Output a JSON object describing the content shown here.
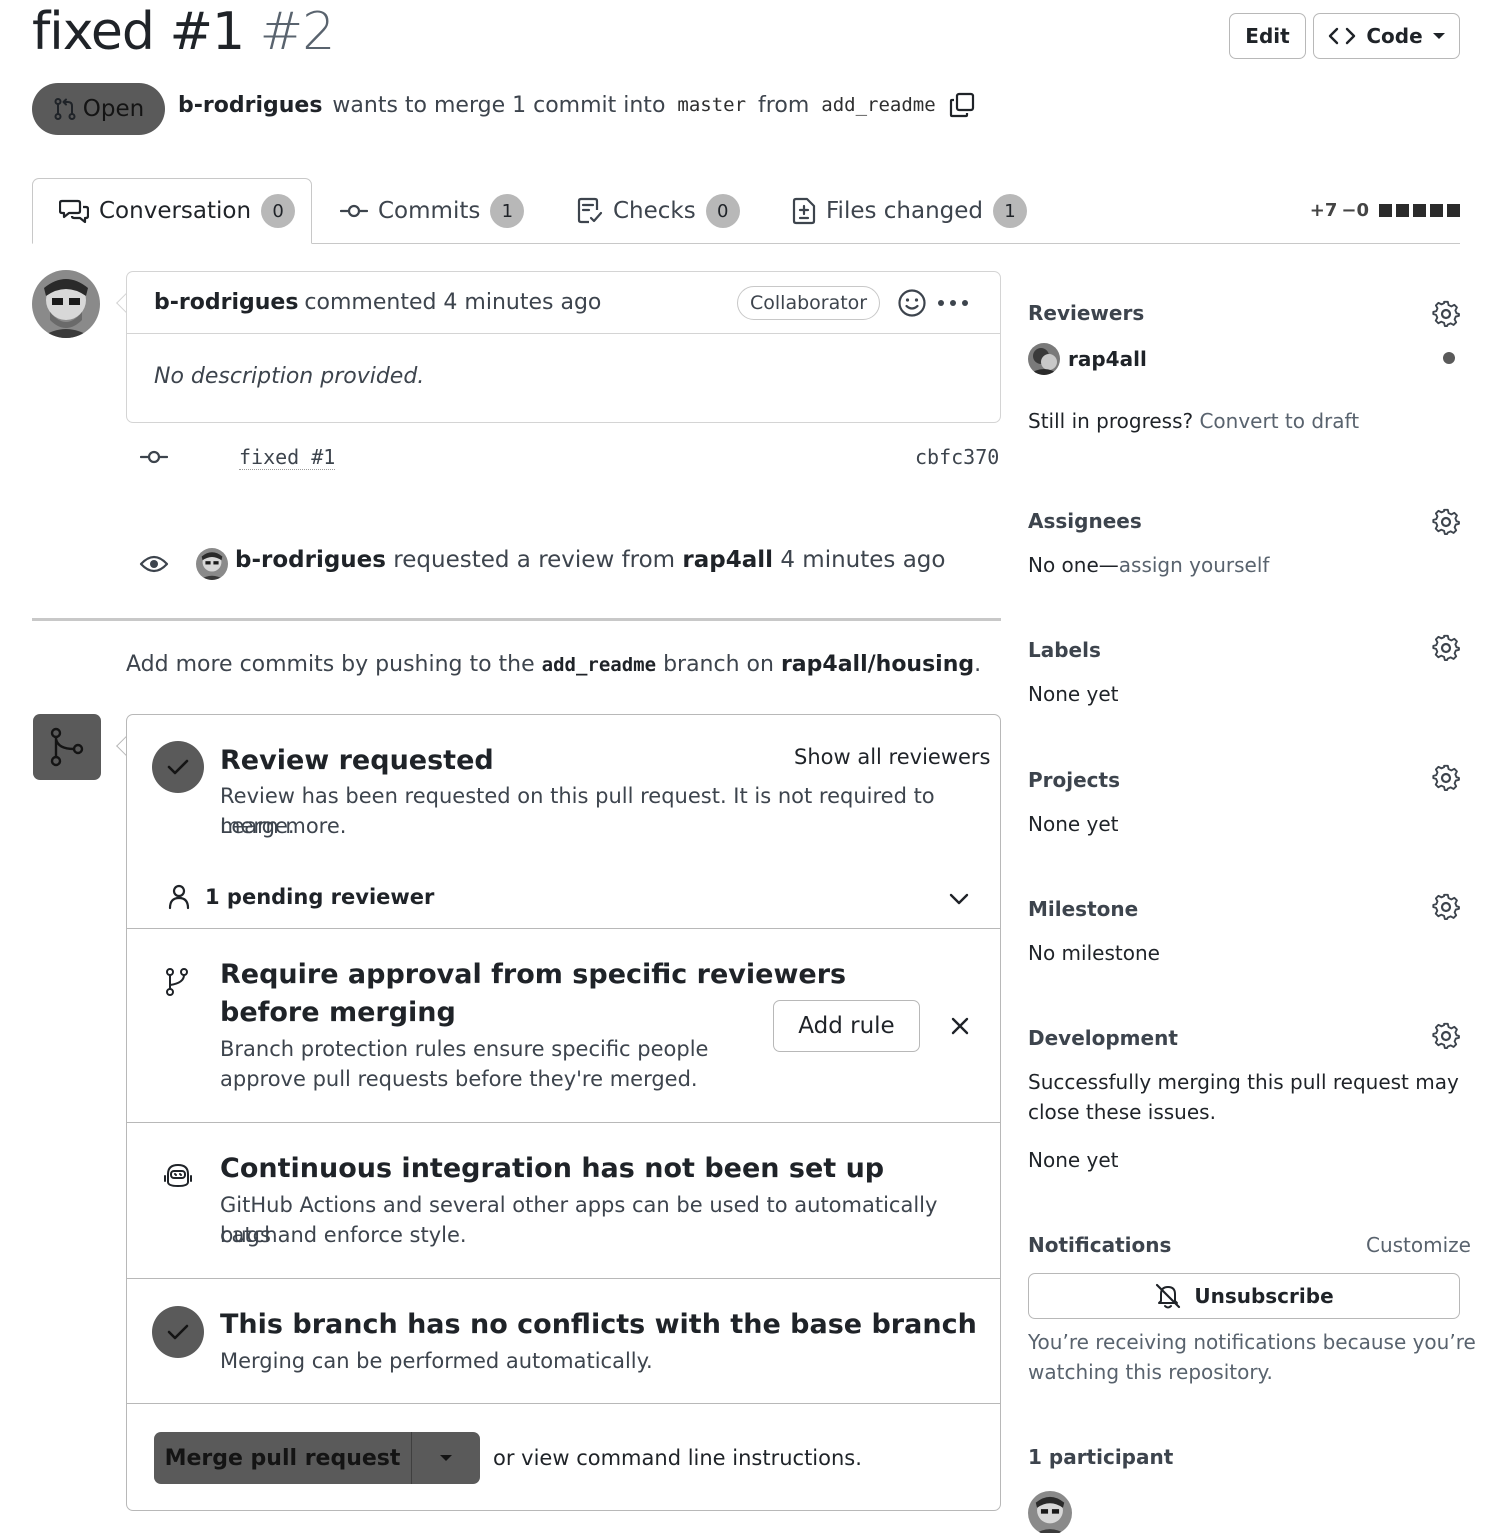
{
  "header": {
    "title": "fixed #1",
    "number": "#2",
    "edit_label": "Edit",
    "code_label": "Code",
    "state_label": "Open",
    "author": "b-rodrigues",
    "merge_text": "wants to merge 1 commit into",
    "base_branch": "master",
    "from_text": "from",
    "head_branch": "add_readme"
  },
  "tabs": [
    {
      "label": "Conversation",
      "count": "0"
    },
    {
      "label": "Commits",
      "count": "1"
    },
    {
      "label": "Checks",
      "count": "0"
    },
    {
      "label": "Files changed",
      "count": "1"
    }
  ],
  "diffstat": {
    "added": "+7",
    "removed": "−0"
  },
  "comment": {
    "author": "b-rodrigues",
    "action": "commented 4 minutes ago",
    "role_badge": "Collaborator",
    "body": "No description provided."
  },
  "commit": {
    "message": "fixed #1",
    "sha": "cbfc370"
  },
  "review_event": {
    "actor": "b-rodrigues",
    "text": "requested a review from",
    "reviewer": "rap4all",
    "time": "4 minutes ago"
  },
  "push_note": {
    "prefix": "Add more commits by pushing to the",
    "branch": "add_readme",
    "middle": "branch on",
    "repo": "rap4all/housing",
    "suffix": "."
  },
  "merge_box": {
    "review": {
      "title": "Review requested",
      "show_all": "Show all reviewers",
      "desc": "Review has been requested on this pull request. It is not required to merge.",
      "learn_more": "Learn more.",
      "pending": "1 pending reviewer"
    },
    "rule": {
      "title_line1": "Require approval from specific reviewers",
      "title_line2": "before merging",
      "desc_line1": "Branch protection rules ensure specific people",
      "desc_line2": "approve pull requests before they're merged.",
      "button": "Add rule"
    },
    "ci": {
      "title": "Continuous integration has not been set up",
      "desc_line1": "GitHub Actions and several other apps can be used to automatically catch",
      "desc_line2": "bugs and enforce style."
    },
    "conflicts": {
      "title": "This branch has no conflicts with the base branch",
      "desc": "Merging can be performed automatically."
    },
    "merge_button": "Merge pull request",
    "cli_prefix": "or view",
    "cli_link": "command line instructions."
  },
  "sidebar": {
    "reviewers": {
      "heading": "Reviewers",
      "name": "rap4all"
    },
    "draft": {
      "prefix": "Still in progress?",
      "link": "Convert to draft"
    },
    "assignees": {
      "heading": "Assignees",
      "prefix": "No one—",
      "link": "assign yourself"
    },
    "labels": {
      "heading": "Labels",
      "value": "None yet"
    },
    "projects": {
      "heading": "Projects",
      "value": "None yet"
    },
    "milestone": {
      "heading": "Milestone",
      "value": "No milestone"
    },
    "development": {
      "heading": "Development",
      "desc_line1": "Successfully merging this pull request may",
      "desc_line2": "close these issues.",
      "value": "None yet"
    },
    "notifications": {
      "heading": "Notifications",
      "customize": "Customize",
      "button": "Unsubscribe",
      "desc_line1": "You’re receiving notifications because you’re",
      "desc_line2": "watching this repository."
    },
    "participants": {
      "heading": "1 participant"
    }
  },
  "icons": {
    "state": "git-pull-request-icon",
    "copy": "copy-icon",
    "conversation": "comment-discussion-icon",
    "commits": "git-commit-icon",
    "checks": "checklist-icon",
    "files": "file-diff-icon",
    "gear": "gear-icon",
    "eye": "eye-icon",
    "merge": "git-merge-icon",
    "bell": "bell-slash-icon"
  }
}
